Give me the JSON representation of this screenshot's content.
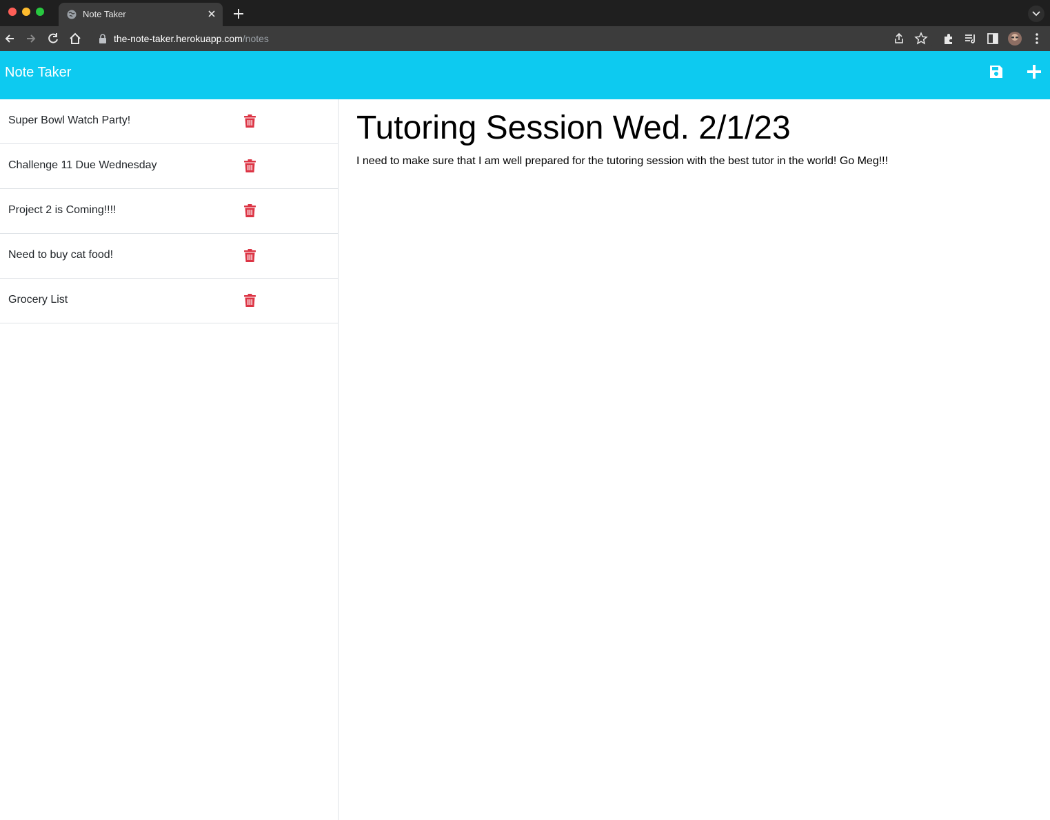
{
  "browser": {
    "tab_title": "Note Taker",
    "url_host": "the-note-taker.herokuapp.com",
    "url_path": "/notes",
    "icons": [
      "globe-icon",
      "close-icon",
      "plus-icon",
      "chevron-down-icon",
      "back-arrow-icon",
      "forward-arrow-icon",
      "reload-icon",
      "home-icon",
      "lock-icon",
      "share-icon",
      "star-icon",
      "extensions-icon",
      "reading-list-icon",
      "side-panel-icon",
      "profile-avatar",
      "kebab-menu-icon"
    ]
  },
  "app": {
    "brand": "Note Taker",
    "accent_color": "#0dcaf0",
    "delete_color": "#dc3545",
    "nav_icons": [
      "save-icon",
      "plus-icon"
    ]
  },
  "notes": [
    {
      "title": "Super Bowl Watch Party!"
    },
    {
      "title": "Challenge 11 Due Wednesday"
    },
    {
      "title": "Project 2 is Coming!!!!"
    },
    {
      "title": "Need to buy cat food!"
    },
    {
      "title": "Grocery List"
    }
  ],
  "active_note": {
    "title": "Tutoring Session Wed. 2/1/23",
    "text": "I need to make sure that I am well prepared for the tutoring session with the best tutor in the world! Go Meg!!!"
  }
}
